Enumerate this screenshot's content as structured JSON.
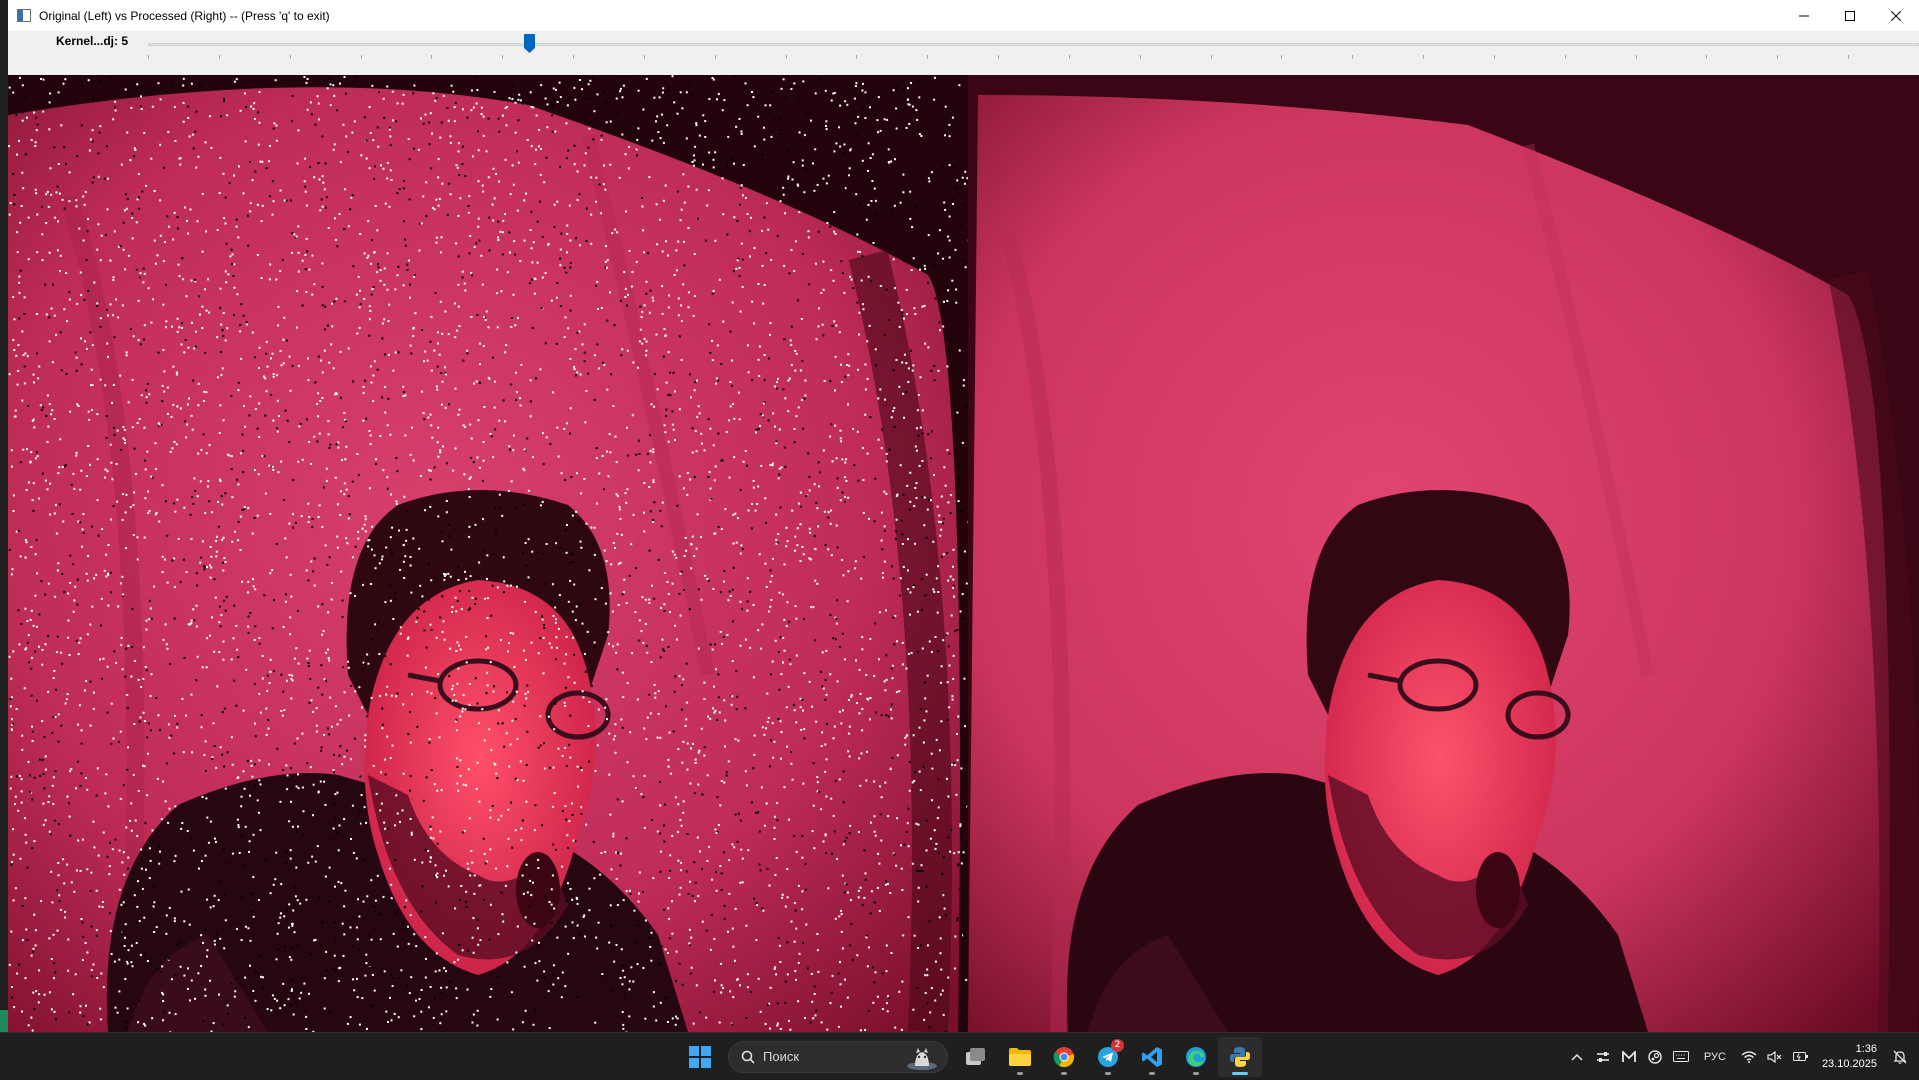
{
  "window": {
    "title": "Original (Left) vs Processed (Right) -- (Press 'q' to exit)",
    "controls": [
      "minimize-icon",
      "maximize-icon",
      "close-icon"
    ]
  },
  "trackbar": {
    "label": "Kernel...dj:",
    "value": "5",
    "value_fraction": 0.215
  },
  "panels": {
    "left": {
      "description_name": "original-noisy-frame"
    },
    "right": {
      "description_name": "processed-filtered-frame"
    }
  },
  "colors": {
    "frame_pink": "#d43a67",
    "frame_dark": "#2a0610",
    "slider_thumb": "#0067c0",
    "taskbar_bg": "#1f1f1f"
  },
  "taskbar": {
    "search_placeholder": "Поиск",
    "apps": [
      "windows-start-icon",
      "task-view-icon",
      "file-explorer-icon",
      "chrome-icon",
      "telegram-icon",
      "vscode-icon",
      "edge-icon",
      "python-icon"
    ],
    "telegram_badge": "2",
    "language": "РУС",
    "time": "1:36",
    "date": "23.10.2025"
  }
}
